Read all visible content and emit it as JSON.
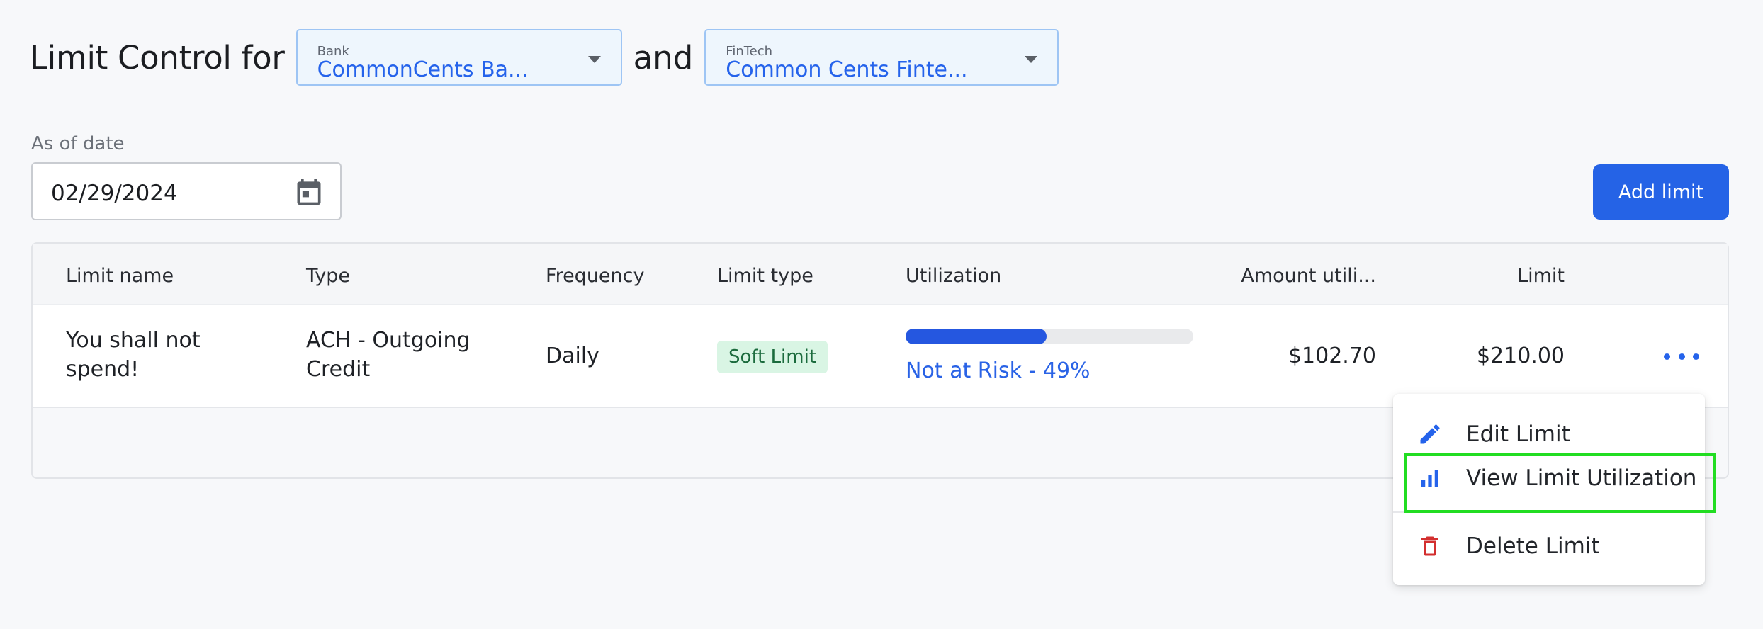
{
  "header": {
    "title": "Limit Control for",
    "and_text": "and",
    "bank": {
      "label": "Bank",
      "value": "CommonCents Ba..."
    },
    "fintech": {
      "label": "FinTech",
      "value": "Common Cents Finte..."
    }
  },
  "date": {
    "label": "As of date",
    "value": "02/29/2024"
  },
  "add_button": "Add limit",
  "table": {
    "columns": [
      "Limit name",
      "Type",
      "Frequency",
      "Limit type",
      "Utilization",
      "Amount utili...",
      "Limit"
    ],
    "rows": [
      {
        "name_line1": "You shall not",
        "name_line2": "spend!",
        "type_line1": "ACH - Outgoing",
        "type_line2": "Credit",
        "frequency": "Daily",
        "limit_type": "Soft Limit",
        "utilization_percent": 49,
        "utilization_text": "Not at Risk - 49%",
        "amount_utilized": "$102.70",
        "limit": "$210.00"
      }
    ]
  },
  "menu": {
    "items": [
      {
        "label": "Edit Limit",
        "icon": "pencil-icon"
      },
      {
        "label": "View Limit Utilization",
        "icon": "bar-chart-icon"
      },
      {
        "label": "Delete Limit",
        "icon": "trash-icon"
      }
    ]
  },
  "colors": {
    "accent": "#2563eb",
    "badge_bg": "#d9f5e4",
    "badge_text": "#1b6b3d",
    "delete": "#d32f2f",
    "highlight": "#22dd22"
  }
}
